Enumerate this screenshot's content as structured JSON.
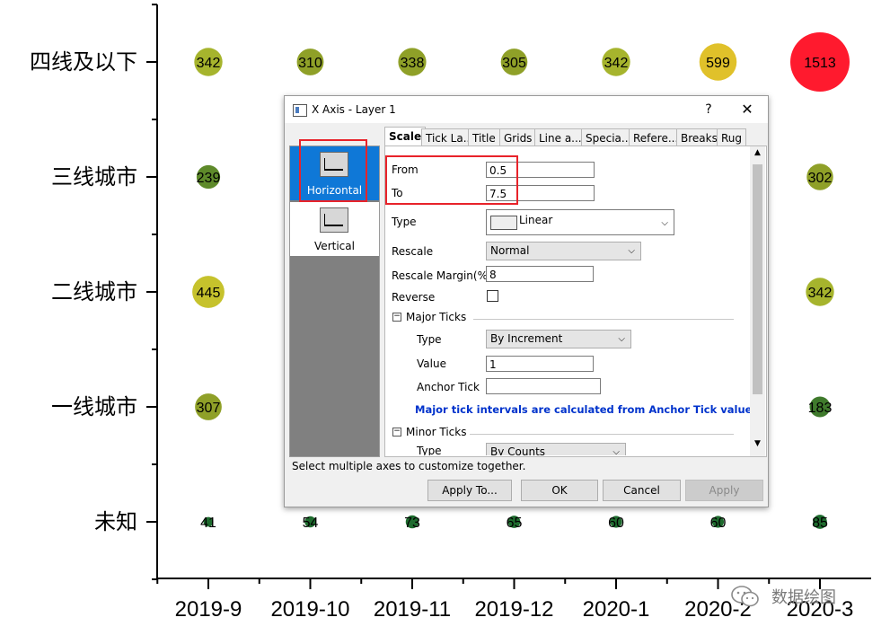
{
  "chart_data": {
    "type": "scatter",
    "x_categories": [
      "2019-9",
      "2019-10",
      "2019-11",
      "2019-12",
      "2020-1",
      "2020-2",
      "2020-3"
    ],
    "y_categories": [
      "未知",
      "一线城市",
      "二线城市",
      "三线城市",
      "四线及以下"
    ],
    "points": [
      {
        "x": "2019-9",
        "y": "四线及以下",
        "value": 342,
        "color": "#a6b42d"
      },
      {
        "x": "2019-10",
        "y": "四线及以下",
        "value": 310,
        "color": "#8fa028"
      },
      {
        "x": "2019-11",
        "y": "四线及以下",
        "value": 338,
        "color": "#8fa028"
      },
      {
        "x": "2019-12",
        "y": "四线及以下",
        "value": 305,
        "color": "#8fa028"
      },
      {
        "x": "2020-1",
        "y": "四线及以下",
        "value": 342,
        "color": "#a6b42d"
      },
      {
        "x": "2020-2",
        "y": "四线及以下",
        "value": 599,
        "color": "#e0c12a"
      },
      {
        "x": "2020-3",
        "y": "四线及以下",
        "value": 1513,
        "color": "#ff1a2e"
      },
      {
        "x": "2019-9",
        "y": "三线城市",
        "value": 239,
        "color": "#5e8a2a"
      },
      {
        "x": "2020-3",
        "y": "三线城市",
        "value": 302,
        "color": "#8fa028"
      },
      {
        "x": "2019-9",
        "y": "二线城市",
        "value": 445,
        "color": "#c6c22c"
      },
      {
        "x": "2020-3",
        "y": "二线城市",
        "value": 342,
        "color": "#a6b42d"
      },
      {
        "x": "2019-9",
        "y": "一线城市",
        "value": 307,
        "color": "#8fa028"
      },
      {
        "x": "2020-3",
        "y": "一线城市",
        "value": 183,
        "color": "#3f7a2c"
      },
      {
        "x": "2019-9",
        "y": "未知",
        "value": 41,
        "color": "#1e6b2e"
      },
      {
        "x": "2019-10",
        "y": "未知",
        "value": 54,
        "color": "#1e6b2e"
      },
      {
        "x": "2019-11",
        "y": "未知",
        "value": 73,
        "color": "#1e6b2e"
      },
      {
        "x": "2019-12",
        "y": "未知",
        "value": 65,
        "color": "#1e6b2e"
      },
      {
        "x": "2020-1",
        "y": "未知",
        "value": 60,
        "color": "#1e6b2e"
      },
      {
        "x": "2020-2",
        "y": "未知",
        "value": 60,
        "color": "#1e6b2e"
      },
      {
        "x": "2020-3",
        "y": "未知",
        "value": 85,
        "color": "#1e6b2e"
      }
    ]
  },
  "dialog": {
    "title": "X Axis - Layer 1",
    "help": "?",
    "close": "✕",
    "sidebar": [
      {
        "label": "Horizontal",
        "selected": true
      },
      {
        "label": "Vertical",
        "selected": false
      }
    ],
    "tabs": [
      "Scale",
      "Tick La...",
      "Title",
      "Grids",
      "Line a...",
      "Specia...",
      "Refere...",
      "Breaks",
      "Rug"
    ],
    "scale": {
      "from_label": "From",
      "from_value": "0.5",
      "to_label": "To",
      "to_value": "7.5",
      "type_label": "Type",
      "type_value": "Linear",
      "rescale_label": "Rescale",
      "rescale_value": "Normal",
      "margin_label": "Rescale Margin(%)",
      "margin_value": "8",
      "reverse_label": "Reverse",
      "major_title": "Major Ticks",
      "major_type_label": "Type",
      "major_type_value": "By Increment",
      "value_label": "Value",
      "value_value": "1",
      "anchor_label": "Anchor Tick",
      "anchor_value": "",
      "anchor_note": "Major tick intervals are calculated from Anchor Tick value.",
      "minor_title": "Minor Ticks",
      "minor_type_label": "Type",
      "minor_type_value": "By Counts"
    },
    "hint": "Select multiple axes to customize together.",
    "buttons": {
      "apply_to": "Apply To...",
      "ok": "OK",
      "cancel": "Cancel",
      "apply": "Apply"
    }
  },
  "watermark": "数据绘图",
  "colors": {
    "highlight": "#e8232a",
    "selected": "#0f78d7",
    "note": "#0033cc"
  }
}
